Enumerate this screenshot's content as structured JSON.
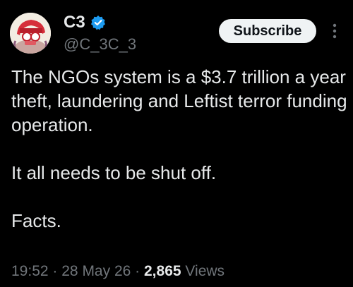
{
  "author": {
    "display_name": "C3",
    "handle": "@C_3C_3",
    "verified": true,
    "verified_color": "#1d9bf0"
  },
  "actions": {
    "subscribe_label": "Subscribe",
    "more_icon": "more-vertical-icon"
  },
  "post": {
    "paragraphs": [
      "The NGOs system is a $3.7 trillion a year theft, laundering and Leftist terror funding operation.",
      "It all needs to be shut off.",
      "Facts."
    ]
  },
  "meta": {
    "time": "19:52",
    "separator": "·",
    "date": "28 May 26",
    "views_count": "2,865",
    "views_label": "Views"
  },
  "colors": {
    "background": "#000000",
    "text": "#e7e9ea",
    "secondary_text": "#71767b",
    "button_bg": "#eff3f4",
    "button_text": "#0f1419"
  }
}
